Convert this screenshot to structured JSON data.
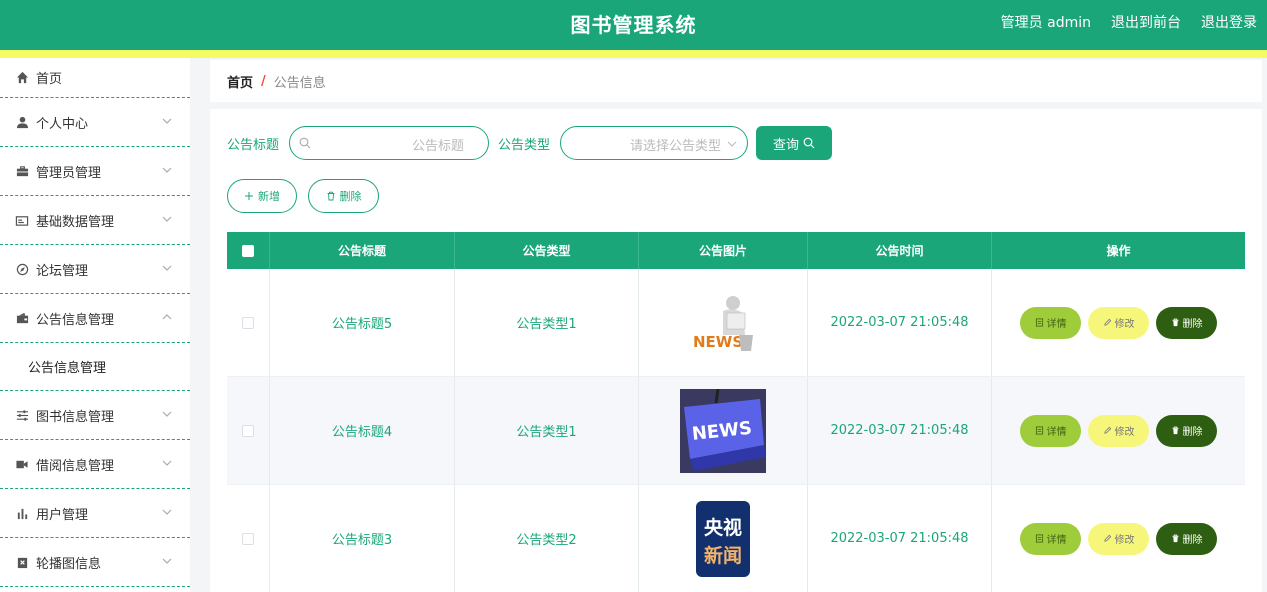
{
  "header": {
    "title": "图书管理系统",
    "admin_label": "管理员 admin",
    "front_link": "退出到前台",
    "logout_link": "退出登录"
  },
  "sidebar": {
    "items": [
      {
        "label": "首页",
        "icon": "home-icon"
      },
      {
        "label": "个人中心",
        "icon": "user-icon"
      },
      {
        "label": "管理员管理",
        "icon": "briefcase-icon"
      },
      {
        "label": "基础数据管理",
        "icon": "card-icon"
      },
      {
        "label": "论坛管理",
        "icon": "compass-icon"
      },
      {
        "label": "公告信息管理",
        "icon": "wallet-icon"
      },
      {
        "label": "图书信息管理",
        "icon": "sliders-icon"
      },
      {
        "label": "借阅信息管理",
        "icon": "video-icon"
      },
      {
        "label": "用户管理",
        "icon": "bar-chart-icon"
      },
      {
        "label": "轮播图信息",
        "icon": "clipboard-icon"
      }
    ],
    "submenu_label": "公告信息管理"
  },
  "breadcrumb": {
    "home": "首页",
    "separator": "/",
    "current": "公告信息"
  },
  "search": {
    "title_label": "公告标题",
    "title_placeholder": "公告标题",
    "type_label": "公告类型",
    "type_placeholder": "请选择公告类型",
    "query_button": "查询"
  },
  "actions": {
    "add_button": "新增",
    "delete_button": "删除"
  },
  "table": {
    "headers": [
      "公告标题",
      "公告类型",
      "公告图片",
      "公告时间",
      "操作"
    ],
    "rows": [
      {
        "title": "公告标题5",
        "type": "公告类型1",
        "image": "news-reader-image",
        "time": "2022-03-07 21:05:48"
      },
      {
        "title": "公告标题4",
        "type": "公告类型1",
        "image": "news-key-image",
        "time": "2022-03-07 21:05:48"
      },
      {
        "title": "公告标题3",
        "type": "公告类型2",
        "image": "cctv-news-image",
        "time": "2022-03-07 21:05:48"
      }
    ],
    "row_actions": {
      "detail": "详情",
      "edit": "修改",
      "delete": "删除"
    }
  },
  "images": {
    "key_text": "NEWS",
    "badge_top": "央视",
    "badge_bottom": "新闻",
    "reader_text": "NEWS"
  },
  "colors": {
    "primary": "#1ba67a",
    "accent_bar": "#f3fd63",
    "detail": "#9fcc3b",
    "edit": "#f6f77a",
    "delete": "#2e5e12"
  }
}
